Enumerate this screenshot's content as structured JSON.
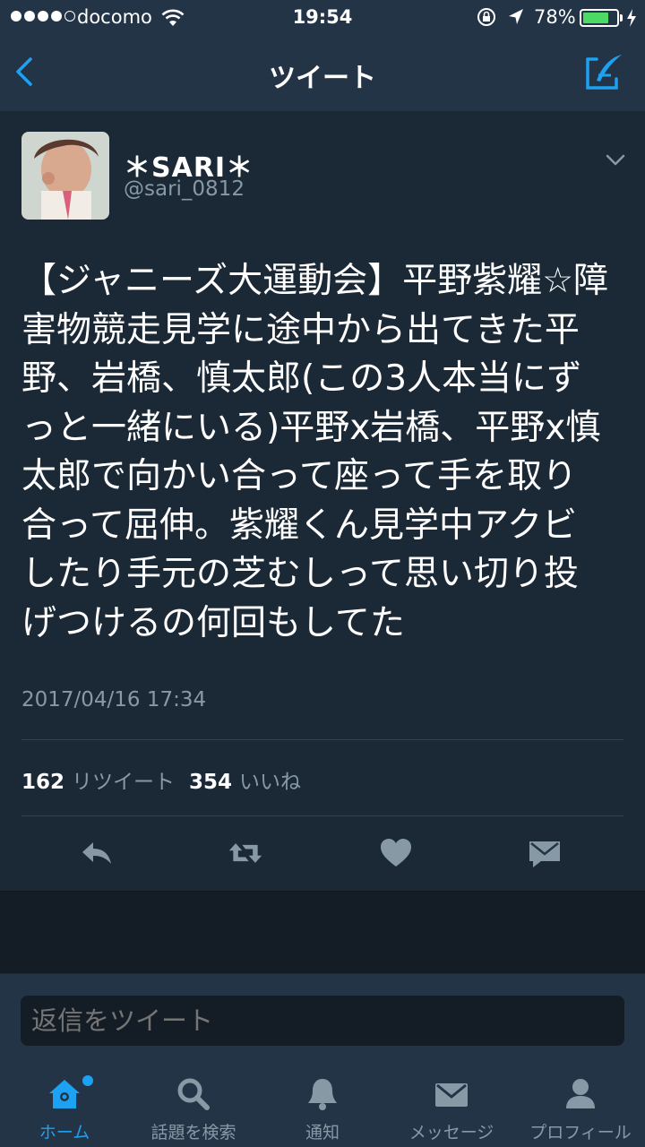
{
  "status_bar": {
    "carrier": "docomo",
    "time": "19:54",
    "battery": "78%",
    "battery_level": 0.78,
    "icons": [
      "signal-dots",
      "wifi-icon",
      "rotation-lock-icon",
      "location-icon",
      "battery-icon",
      "charging-icon"
    ]
  },
  "nav": {
    "title": "ツイート",
    "back_icon": "back-chevron-icon",
    "compose_icon": "compose-tweet-icon"
  },
  "tweet": {
    "display_name": "＊SARI＊",
    "handle": "@sari_0812",
    "text_lines": [
      "【ジャニーズ大運動会】平野紫耀☆障",
      "害物競走見学に途中から出てきた平",
      "野、岩橋、慎太郎(この3人本当にず",
      "っと一緒にいる)平野x岩橋、平野x慎",
      "太郎で向かい合って座って手を取り",
      "合って屈伸。紫耀くん見学中アクビ",
      "したり手元の芝むしって思い切り投",
      "げつけるの何回もしてた"
    ],
    "timestamp": "2017/04/16 17:34",
    "retweet_count": "162",
    "retweet_label": "リツイート",
    "like_count": "354",
    "like_label": "いいね"
  },
  "actions": [
    "reply-icon",
    "retweet-icon",
    "like-icon",
    "direct-message-icon"
  ],
  "reply": {
    "placeholder": "返信をツイート"
  },
  "tabs": [
    {
      "label": "ホーム",
      "icon": "home-icon",
      "active": true
    },
    {
      "label": "話題を検索",
      "icon": "search-icon",
      "active": false
    },
    {
      "label": "通知",
      "icon": "bell-icon",
      "active": false
    },
    {
      "label": "メッセージ",
      "icon": "envelope-icon",
      "active": false
    },
    {
      "label": "プロフィール",
      "icon": "profile-icon",
      "active": false
    }
  ],
  "colors": {
    "background": "#1b2836",
    "bar": "#243447",
    "accent": "#1da1f2",
    "secondary_text": "#8899a6"
  }
}
